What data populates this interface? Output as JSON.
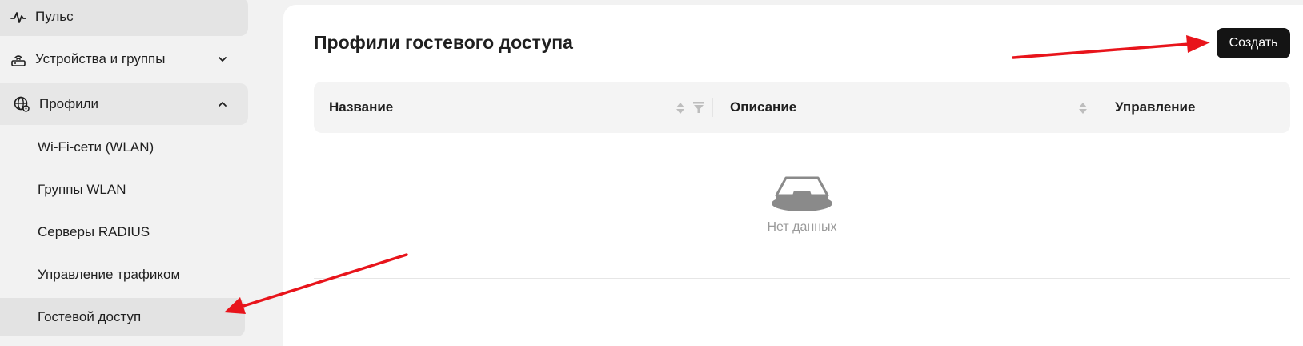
{
  "sidebar": {
    "items": [
      {
        "label": "Пульс",
        "icon": "pulse-icon"
      },
      {
        "label": "Устройства и группы",
        "icon": "router-icon",
        "chevron": "chevron-down-icon"
      },
      {
        "label": "Профили",
        "icon": "globe-settings-icon",
        "chevron": "chevron-up-icon"
      }
    ],
    "sub_items": [
      {
        "label": "Wi-Fi-сети (WLAN)"
      },
      {
        "label": "Группы WLAN"
      },
      {
        "label": "Серверы RADIUS"
      },
      {
        "label": "Управление трафиком"
      },
      {
        "label": "Гостевой доступ",
        "selected": true
      }
    ]
  },
  "main": {
    "title": "Профили гостевого доступа",
    "create_label": "Создать",
    "table": {
      "columns": [
        "Название",
        "Описание",
        "Управление"
      ]
    },
    "empty_text": "Нет данных"
  },
  "annotations": {
    "arrow_color": "#e8141b"
  }
}
